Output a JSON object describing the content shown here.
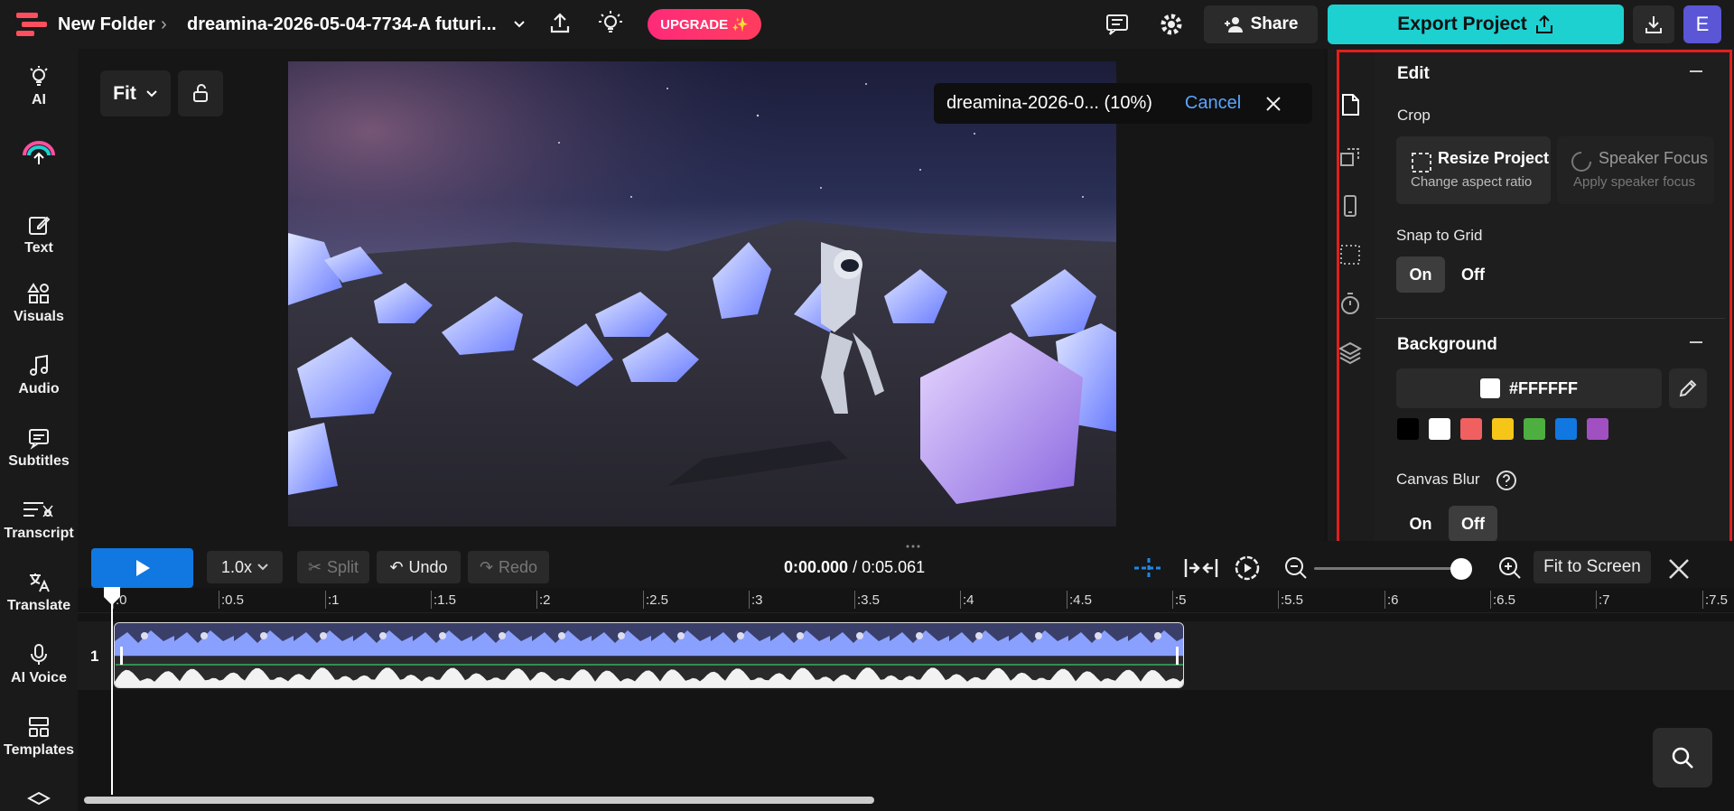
{
  "topbar": {
    "folder": "New Folder",
    "project_name": "dreamina-2026-05-04-7734-A futuri...",
    "upgrade_label": "UPGRADE",
    "share_label": "Share",
    "export_label": "Export Project",
    "avatar_initial": "E"
  },
  "leftnav": {
    "items": [
      {
        "label": "AI",
        "icon": "bulb-icon"
      },
      {
        "label": "",
        "icon": "cloud-upload-icon"
      },
      {
        "label": "Text",
        "icon": "text-edit-icon"
      },
      {
        "label": "Visuals",
        "icon": "visuals-icon"
      },
      {
        "label": "Audio",
        "icon": "music-icon"
      },
      {
        "label": "Subtitles",
        "icon": "subtitles-icon"
      },
      {
        "label": "Transcript",
        "icon": "transcript-icon"
      },
      {
        "label": "Translate",
        "icon": "translate-icon"
      },
      {
        "label": "AI Voice",
        "icon": "mic-icon"
      },
      {
        "label": "Templates",
        "icon": "templates-icon"
      }
    ]
  },
  "canvas": {
    "fit_label": "Fit",
    "toast_text": "dreamina-2026-0... (10%)",
    "toast_cancel": "Cancel"
  },
  "panel": {
    "edit_title": "Edit",
    "crop_label": "Crop",
    "resize_title": "Resize Project",
    "resize_sub": "Change aspect ratio",
    "speaker_title": "Speaker Focus",
    "speaker_sub": "Apply speaker focus",
    "snap_label": "Snap to Grid",
    "snap_on": "On",
    "snap_off": "Off",
    "background_title": "Background",
    "bg_color": "#FFFFFF",
    "swatches": [
      "#000000",
      "#ffffff",
      "#f06060",
      "#f5c518",
      "#4caf3f",
      "#1078e0",
      "#a050c0"
    ],
    "blur_label": "Canvas Blur",
    "blur_on": "On",
    "blur_off": "Off"
  },
  "timeline": {
    "speed": "1.0x",
    "split": "Split",
    "undo": "Undo",
    "redo": "Redo",
    "current_time": "0:00.000",
    "total_time": "/ 0:05.061",
    "fit_screen": "Fit to Screen",
    "track_number": "1",
    "ticks": [
      ":0",
      ":0.5",
      ":1",
      ":1.5",
      ":2",
      ":2.5",
      ":3",
      ":3.5",
      ":4",
      ":4.5",
      ":5",
      ":5.5",
      ":6",
      ":6.5",
      ":7",
      ":7.5"
    ]
  }
}
